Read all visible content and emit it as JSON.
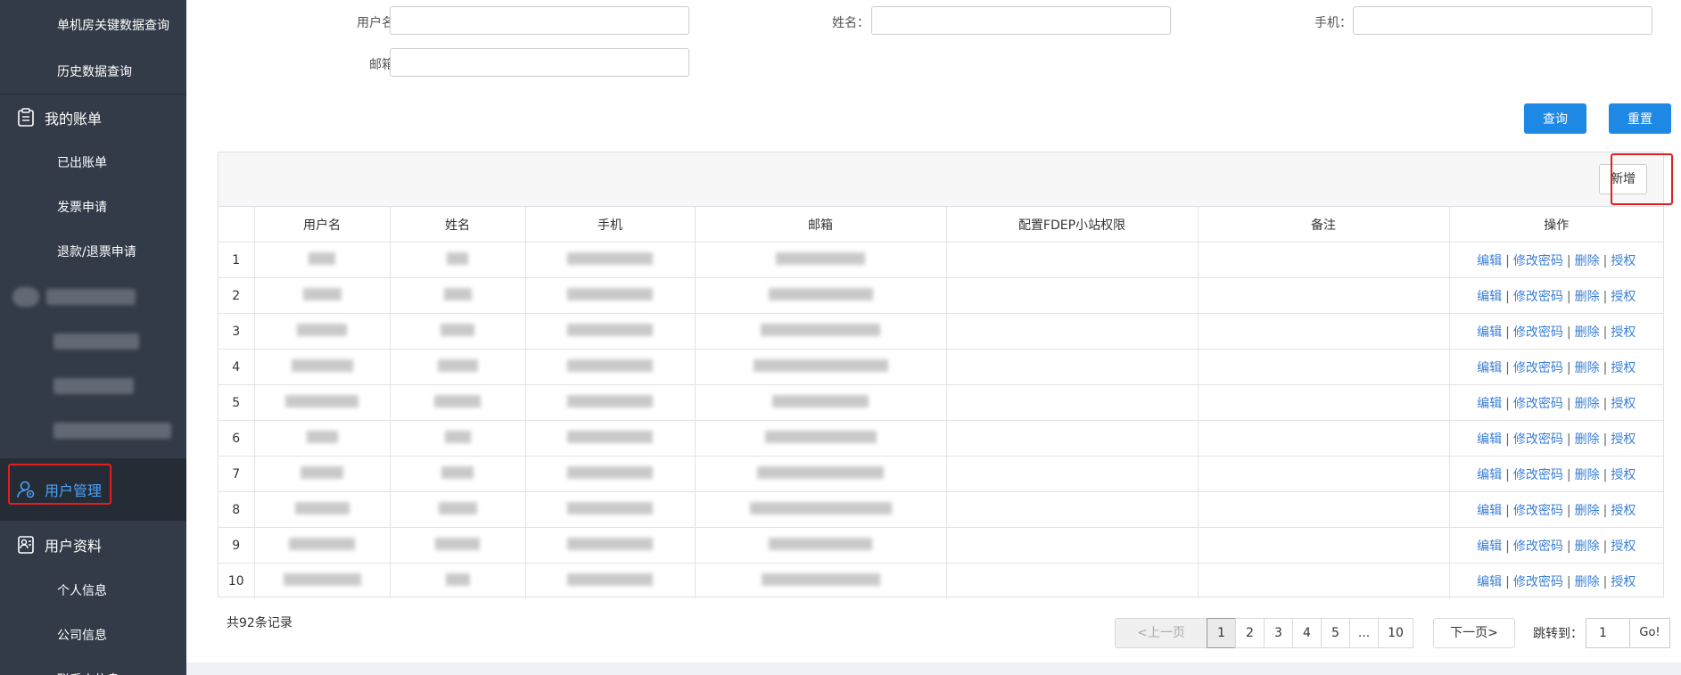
{
  "sidebar": {
    "sub_items_top": [
      {
        "label": "单机房关键数据查询"
      },
      {
        "label": "历史数据查询"
      }
    ],
    "groups": [
      {
        "label": "我的账单",
        "icon": "bill-icon",
        "items": [
          {
            "label": "已出账单"
          },
          {
            "label": "发票申请"
          },
          {
            "label": "退款/退票申请"
          }
        ]
      },
      {
        "label": "用户管理",
        "icon": "user-manage-icon",
        "active": true
      },
      {
        "label": "用户资料",
        "icon": "profile-icon",
        "items": [
          {
            "label": "个人信息"
          },
          {
            "label": "公司信息"
          },
          {
            "label": "联系人信息"
          }
        ]
      }
    ],
    "active_color": "#4aa3f7"
  },
  "filters": {
    "username_label": "用户名：",
    "name_label": "姓名：",
    "phone_label": "手机：",
    "email_label": "邮箱："
  },
  "buttons": {
    "query": "查询",
    "reset": "重置",
    "add": "新增"
  },
  "table": {
    "columns": [
      "",
      "用户名",
      "姓名",
      "手机",
      "邮箱",
      "配置FDEP小站权限",
      "备注",
      "操作"
    ],
    "row_indices": [
      "1",
      "2",
      "3",
      "4",
      "5",
      "6",
      "7",
      "8",
      "9",
      "10"
    ],
    "actions": [
      "编辑",
      "修改密码",
      "删除",
      "授权"
    ]
  },
  "footer": {
    "total": "共92条记录",
    "prev": "<上一页",
    "pages": [
      "1",
      "2",
      "3",
      "4",
      "5",
      "...",
      "10"
    ],
    "current_page": "1",
    "next": "下一页>",
    "jump_label": "跳转到：",
    "jump_value": "1",
    "go": "Go!"
  }
}
